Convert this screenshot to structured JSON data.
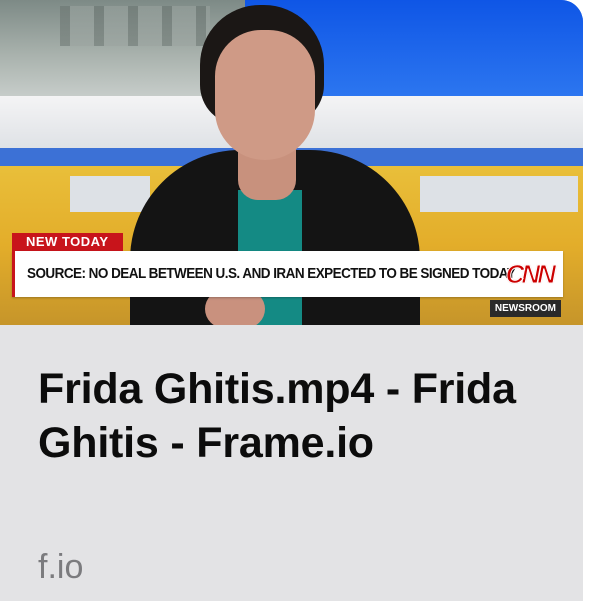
{
  "thumbnail": {
    "tag": "NEW TODAY",
    "headline": "SOURCE: NO DEAL BETWEEN U.S. AND IRAN EXPECTED TO BE SIGNED TODAY",
    "network": "CNN",
    "show": "NEWSROOM"
  },
  "link": {
    "title": "Frida Ghitis.mp4 - Frida Ghitis - Frame.io",
    "domain": "f.io"
  },
  "colors": {
    "accent_red": "#c8141b",
    "caption_bg": "#e3e3e5",
    "domain_gray": "#7b7b7e"
  }
}
